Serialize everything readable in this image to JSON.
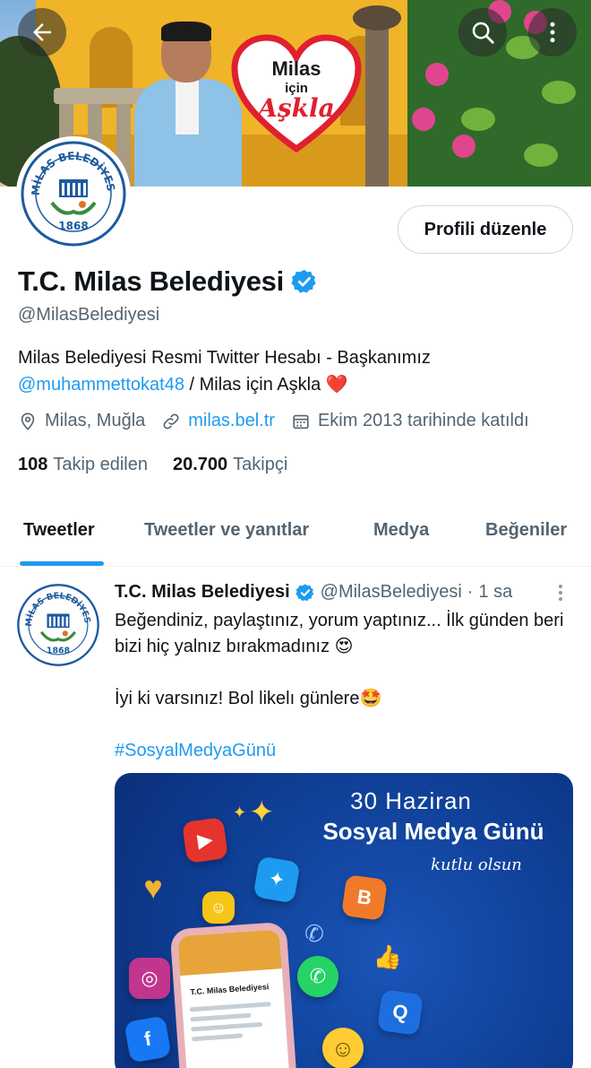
{
  "banner": {
    "heart_line1": "Milas",
    "heart_line2": "için",
    "heart_line3": "Aşkla"
  },
  "header": {
    "back_icon": "arrow-left-icon",
    "search_icon": "search-icon",
    "more_icon": "more-vertical-icon"
  },
  "profile": {
    "edit_button": "Profili düzenle",
    "display_name": "T.C. Milas Belediyesi",
    "handle": "@MilasBelediyesi",
    "bio_text": "Milas Belediyesi Resmi Twitter Hesabı - Başkanımız",
    "bio_mention": "@muhammettokat48",
    "bio_suffix": " / Milas için Aşkla ",
    "bio_emoji": "❤️",
    "location": "Milas, Muğla",
    "website": "milas.bel.tr",
    "joined": "Ekim 2013 tarihinde katıldı",
    "following_count": "108",
    "following_label": "Takip edilen",
    "followers_count": "20.700",
    "followers_label": "Takipçi",
    "logo_text_top": "MİLAS BELEDİYESİ",
    "logo_year": "1868"
  },
  "tabs": [
    {
      "label": "Tweetler",
      "active": true
    },
    {
      "label": "Tweetler ve yanıtlar",
      "active": false
    },
    {
      "label": "Medya",
      "active": false
    },
    {
      "label": "Beğeniler",
      "active": false
    }
  ],
  "tweet": {
    "author_name": "T.C. Milas Belediyesi",
    "author_handle": "@MilasBelediyesi",
    "separator": "·",
    "time": "1 sa",
    "line1": "Beğendiniz, paylaştınız, yorum yaptınız... İlk günden beri bizi hiç yalnız bırakmadınız 😍",
    "line2": "İyi ki varsınız! Bol likelı günlere🤩",
    "hashtag": "#SosyalMedyaGünü",
    "media": {
      "line1": "30 Haziran",
      "line2": "Sosyal Medya Günü",
      "line3": "kutlu olsun",
      "phone_title": "T.C. Milas Belediyesi"
    }
  },
  "colors": {
    "accent": "#1d9bf0",
    "text_primary": "#0f1419",
    "text_secondary": "#536471"
  }
}
